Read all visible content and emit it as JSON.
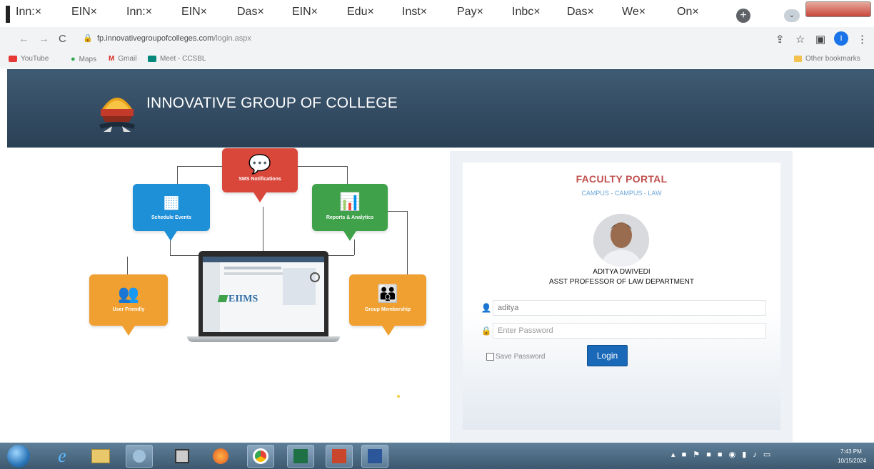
{
  "browser": {
    "tabs": [
      {
        "label": "Inn:",
        "icon": "globe-icon"
      },
      {
        "label": "EIN",
        "icon": "globe-icon"
      },
      {
        "label": "Inn:",
        "icon": "globe-icon"
      },
      {
        "label": "EIN",
        "icon": "globe-icon",
        "active": true
      },
      {
        "label": "Das",
        "icon": "globe-icon"
      },
      {
        "label": "EIN",
        "icon": "globe-icon"
      },
      {
        "label": "Edu",
        "icon": "globe-icon"
      },
      {
        "label": "Inst",
        "icon": "globe-icon"
      },
      {
        "label": "Pay",
        "icon": "globe-icon"
      },
      {
        "label": "Inbc",
        "icon": "gmail-icon"
      },
      {
        "label": "Das",
        "icon": "globe-icon"
      },
      {
        "label": "We",
        "icon": "globe-icon"
      },
      {
        "label": "On",
        "icon": "globe-icon"
      }
    ],
    "tab_close_glyph": "×",
    "url_host": "fp.innovativegroupofcolleges.com",
    "url_path": "/login.aspx",
    "profile_initial": "I",
    "bookmarks": [
      {
        "label": "YouTube",
        "icon": "youtube-icon"
      },
      {
        "label": "Maps",
        "icon": "maps-icon"
      },
      {
        "label": "Gmail",
        "icon": "gmail-icon"
      },
      {
        "label": "Meet - CCSBL",
        "icon": "meet-icon"
      }
    ],
    "other_bookmarks": "Other bookmarks"
  },
  "site": {
    "title": "INNOVATIVE GROUP OF COLLEGE"
  },
  "illustration": {
    "cards": [
      {
        "label": "SMS Notifications",
        "color": "#d9463a"
      },
      {
        "label": "Schedule Events",
        "color": "#1e90d8"
      },
      {
        "label": "Reports & Analytics",
        "color": "#3fa24a"
      },
      {
        "label": "User Friendly",
        "color": "#f0a030"
      },
      {
        "label": "Group Membership",
        "color": "#f0a030"
      }
    ],
    "screen_brand": "EIIMS"
  },
  "login": {
    "portal_title": "FACULTY PORTAL",
    "campus_line": "CAMPUS - CAMPUS - LAW",
    "user_name": "ADITYA DWIVEDI",
    "user_role": "ASST PROFESSOR OF LAW DEPARTMENT",
    "username_value": "aditya",
    "password_placeholder": "Enter Password",
    "save_password_label": "Save Password",
    "login_button": "Login"
  },
  "taskbar": {
    "clock_time": "7:43 PM",
    "clock_date": "10/15/2024"
  },
  "colors": {
    "banner": "#34506a",
    "portal_title": "#c0504d",
    "login_button": "#1a68b8"
  }
}
